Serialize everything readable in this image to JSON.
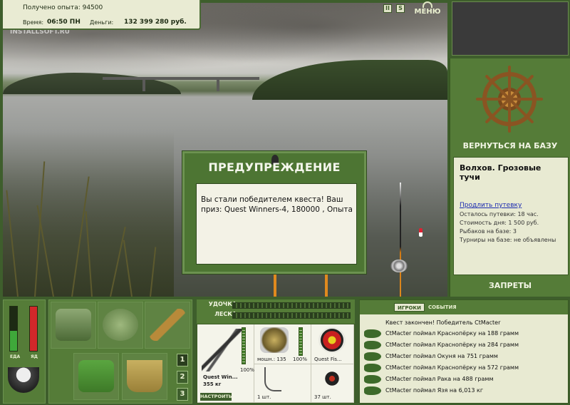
{
  "header": {
    "experience_text": "Получено опыта: 94500",
    "time_label": "Время:",
    "time_value": "06:50 ПН",
    "money_label": "Деньги:",
    "money_value": "132 399 280 руб.",
    "watermark": "INSTALLSOFT.RU",
    "icon_pause": "II",
    "icon_s": "S",
    "menu_label": "МЕНЮ"
  },
  "warning": {
    "title": "ПРЕДУПРЕЖДЕНИЕ",
    "message": "Вы стали победителем квеста! Ваш приз: Quest Winners-4, 180000 , Опыта"
  },
  "right_panel": {
    "home_button": "ВЕРНУТЬСЯ НА БАЗУ",
    "location": "Волхов. Грозовые тучи",
    "extend_link": "Продлить путевку",
    "lines": [
      "Осталось путевки: 18 час.",
      "Стоимость дня: 1 500 руб.",
      "Рыбаков на базе: 3",
      "Турниры на базе: не объявлены"
    ],
    "bans_button": "ЗАПРЕТЫ"
  },
  "status": {
    "food_label": "ЕДА",
    "poison_label": "ЯД",
    "food_level": 0.45,
    "poison_level": 1.0,
    "colors": {
      "food": "#3fa83a",
      "poison": "#d2282a"
    }
  },
  "inventory": {
    "tabs": [
      "1",
      "2",
      "3"
    ],
    "active_tab": 0
  },
  "tackle": {
    "rod_label": "УДОЧКА",
    "line_label": "ЛЕСКА",
    "rod_name": "Quest Win...",
    "rod_weight": "355 кг",
    "rod_pct": "100%",
    "reel_text": "мошн.: 135",
    "reel_pct": "100%",
    "lure_name": "Quest Fis...",
    "hook_count": "1 шт.",
    "bait_count": "37 шт.",
    "setup_button": "НАСТРОИТЬ"
  },
  "events": {
    "tab_players": "ИГРОКИ",
    "tab_events": "СОБЫТИЯ",
    "quest_line": "Квест закончен! Победитель CtMacter",
    "catches": [
      "CtMacter поймал Краснопёрку на 188 грамм",
      "CtMacter поймал Краснопёрку на 284 грамм",
      "CtMacter поймал Окуня на 751 грамм",
      "CtMacter поймал Краснопёрку на 572 грамм",
      "CtMacter поймал Рака на 488 грамм",
      "CtMacter поймал Язя на 6,013 кг"
    ]
  }
}
